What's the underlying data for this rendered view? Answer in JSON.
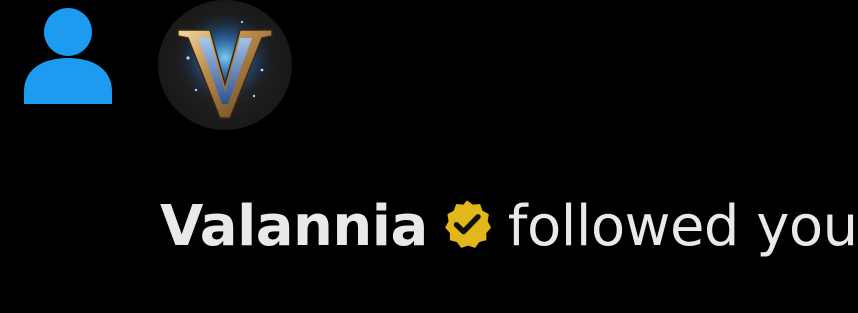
{
  "notification": {
    "type_icon": "person-icon",
    "user": {
      "name": "Valannia",
      "avatar_icon": "valannia-logo-icon",
      "verified": true,
      "badge_icon": "gold-verified-badge-icon"
    },
    "action_text": "followed you"
  },
  "colors": {
    "background": "#000000",
    "person_icon": "#1d9bf0",
    "text": "#e7e9ea",
    "badge_gold": "#e2b719",
    "avatar_bg": "#1f1f1f"
  }
}
